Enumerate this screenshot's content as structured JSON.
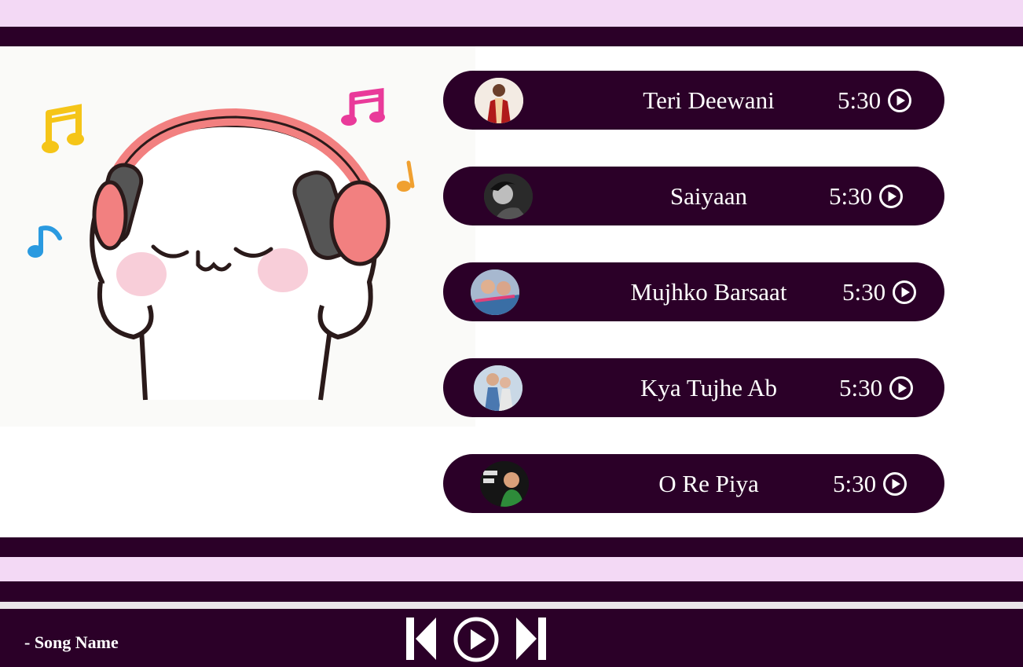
{
  "songs": [
    {
      "title": "Teri Deewani",
      "duration": "5:30",
      "thumb_icon": "singer-portrait-icon"
    },
    {
      "title": "Saiyaan",
      "duration": "5:30",
      "thumb_icon": "singer-portrait-icon"
    },
    {
      "title": "Mujhko Barsaat",
      "duration": "5:30",
      "thumb_icon": "album-art-icon"
    },
    {
      "title": "Kya Tujhe Ab",
      "duration": "5:30",
      "thumb_icon": "album-art-icon"
    },
    {
      "title": "O Re Piya",
      "duration": "5:30",
      "thumb_icon": "album-art-icon"
    }
  ],
  "player": {
    "now_playing": "- Song Name",
    "controls": [
      "previous-icon",
      "play-icon",
      "next-icon"
    ]
  },
  "hero": {
    "icon": "cat-headphones-illustration"
  },
  "colors": {
    "dark": "#2b0028",
    "light": "#f3d9f5",
    "text": "#ffffff"
  }
}
